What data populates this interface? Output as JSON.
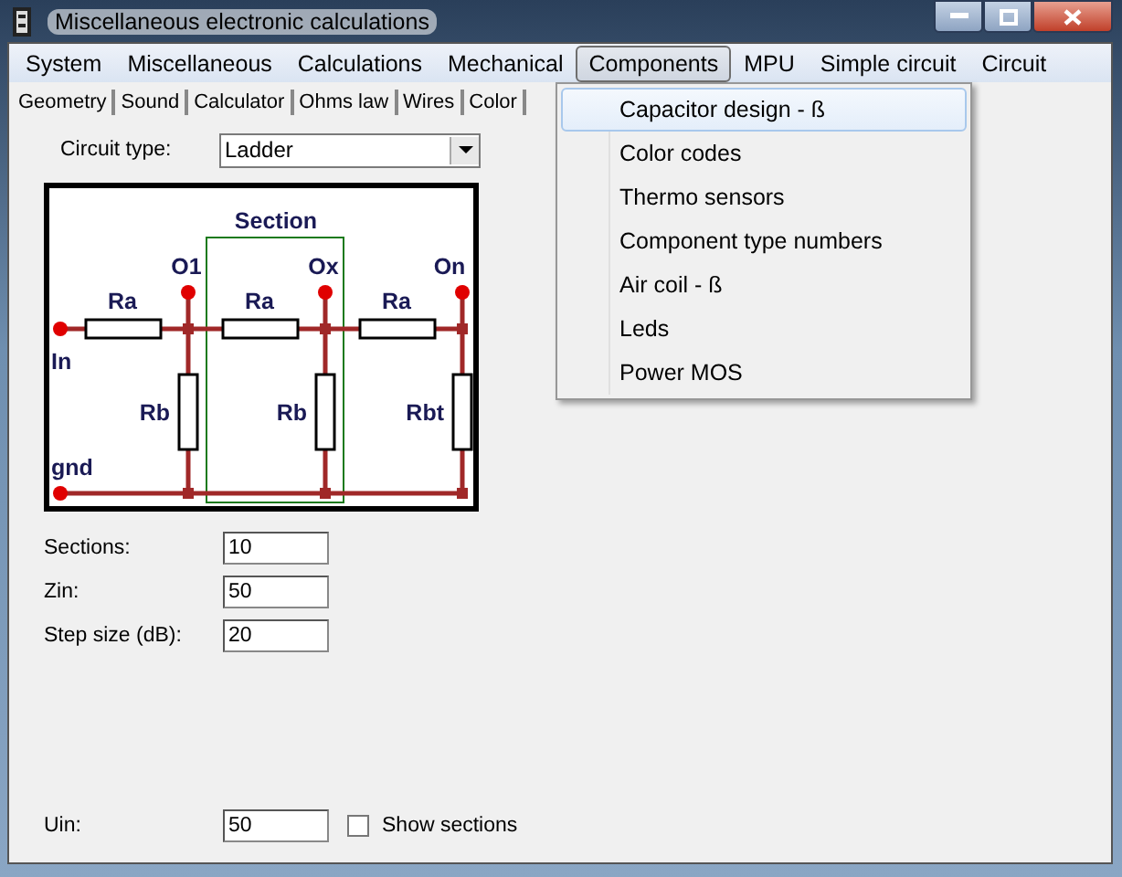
{
  "window": {
    "title": "Miscellaneous electronic calculations"
  },
  "menu_bar": [
    {
      "label": "System",
      "selected": false
    },
    {
      "label": "Miscellaneous",
      "selected": false
    },
    {
      "label": "Calculations",
      "selected": false
    },
    {
      "label": "Mechanical",
      "selected": false
    },
    {
      "label": "Components",
      "selected": true
    },
    {
      "label": "MPU",
      "selected": false
    },
    {
      "label": "Simple circuit",
      "selected": false
    },
    {
      "label": "Circuit",
      "selected": false
    }
  ],
  "tabs": [
    "Geometry",
    "Sound",
    "Calculator",
    "Ohms law",
    "Wires",
    "Color"
  ],
  "circuit_type": {
    "label": "Circuit type:",
    "value": "Ladder"
  },
  "diagram": {
    "section": "Section",
    "input": "In",
    "ground": "gnd",
    "outputs": [
      "O1",
      "Ox",
      "On"
    ],
    "series_resistors": [
      "Ra",
      "Ra",
      "Ra"
    ],
    "shunt_resistors": [
      "Rb",
      "Rb",
      "Rbt"
    ]
  },
  "fields": [
    {
      "label": "Sections:",
      "value": "10"
    },
    {
      "label": "Zin:",
      "value": "50"
    },
    {
      "label": "Step size (dB):",
      "value": "20"
    }
  ],
  "uin": {
    "label": "Uin:",
    "value": "50"
  },
  "show_sections": {
    "label": "Show sections",
    "checked": false
  },
  "components_menu": [
    {
      "label": "Capacitor design - ß",
      "selected": true
    },
    {
      "label": "Color codes",
      "selected": false
    },
    {
      "label": "Thermo sensors",
      "selected": false
    },
    {
      "label": "Component type numbers",
      "selected": false
    },
    {
      "label": "Air coil - ß",
      "selected": false
    },
    {
      "label": "Leds",
      "selected": false
    },
    {
      "label": "Power MOS",
      "selected": false
    }
  ]
}
